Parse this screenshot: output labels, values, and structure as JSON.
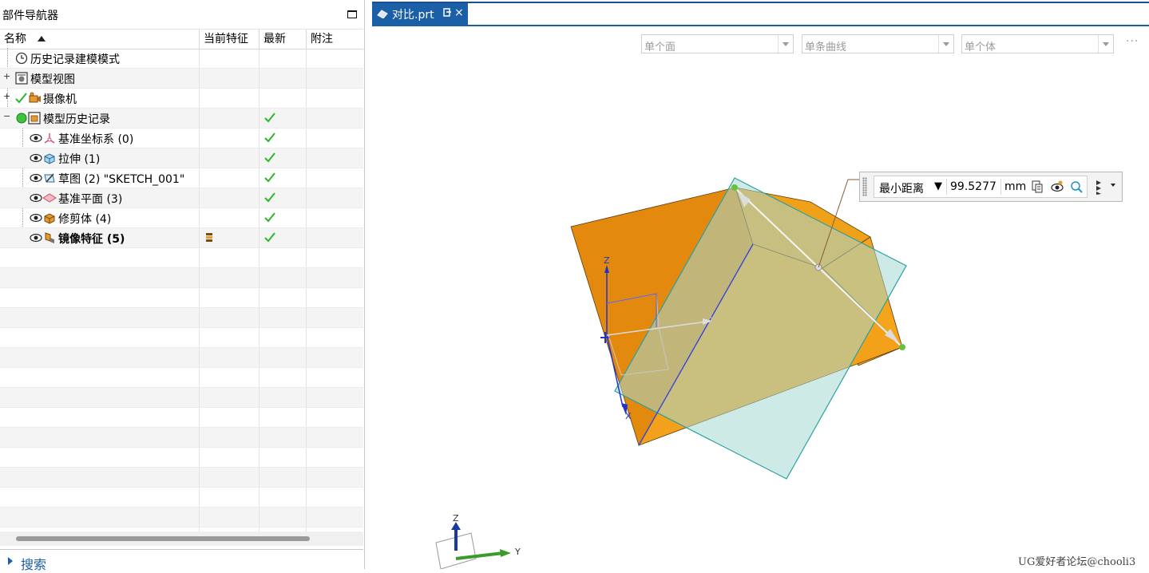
{
  "navigator": {
    "title": "部件导航器",
    "columns": {
      "name": "名称",
      "current_feature": "当前特征",
      "latest": "最新",
      "notes": "附注"
    },
    "rows": [
      {
        "label": "历史记录建模模式",
        "level": 0,
        "expander": "",
        "icon": "clock-icon",
        "latest": false,
        "bold": false
      },
      {
        "label": "模型视图",
        "level": 0,
        "expander": "+",
        "icon": "model-views-icon",
        "latest": false,
        "bold": false
      },
      {
        "label": "摄像机",
        "level": 0,
        "expander": "+",
        "icon": "camera-icon",
        "latest": false,
        "bold": false
      },
      {
        "label": "模型历史记录",
        "level": 0,
        "expander": "−",
        "icon": "model-history-icon",
        "latest": true,
        "bold": false
      },
      {
        "label": "基准坐标系 (0)",
        "level": 1,
        "expander": "",
        "icon": "datum-csys-icon",
        "latest": true,
        "bold": false
      },
      {
        "label": "拉伸 (1)",
        "level": 1,
        "expander": "",
        "icon": "extrude-icon",
        "latest": true,
        "bold": false
      },
      {
        "label": "草图 (2) \"SKETCH_001\"",
        "level": 1,
        "expander": "",
        "icon": "sketch-icon",
        "latest": true,
        "bold": false
      },
      {
        "label": "基准平面 (3)",
        "level": 1,
        "expander": "",
        "icon": "datum-plane-icon",
        "latest": true,
        "bold": false
      },
      {
        "label": "修剪体 (4)",
        "level": 1,
        "expander": "",
        "icon": "trim-body-icon",
        "latest": true,
        "bold": false
      },
      {
        "label": "镜像特征 (5)",
        "level": 1,
        "expander": "",
        "icon": "mirror-feature-icon",
        "latest": true,
        "bold": true
      }
    ],
    "search_label": "搜索"
  },
  "tab": {
    "label": "对比.prt",
    "close": "×"
  },
  "filters": [
    "单个面",
    "单条曲线",
    "单个体"
  ],
  "overflow": "···",
  "measure": {
    "type": "最小距离",
    "caret": "▼",
    "value": "99.5277",
    "unit": "mm"
  },
  "triad": {
    "z": "Z",
    "y": "Y"
  },
  "csys": {
    "z": "Z",
    "y": "Y",
    "x": "X"
  },
  "watermark": "UG爱好者论坛@chooli3",
  "colors": {
    "accent": "#1b5fa6",
    "body": "#e98a10",
    "plane": "#b3e0e0",
    "check": "#2db52d"
  }
}
